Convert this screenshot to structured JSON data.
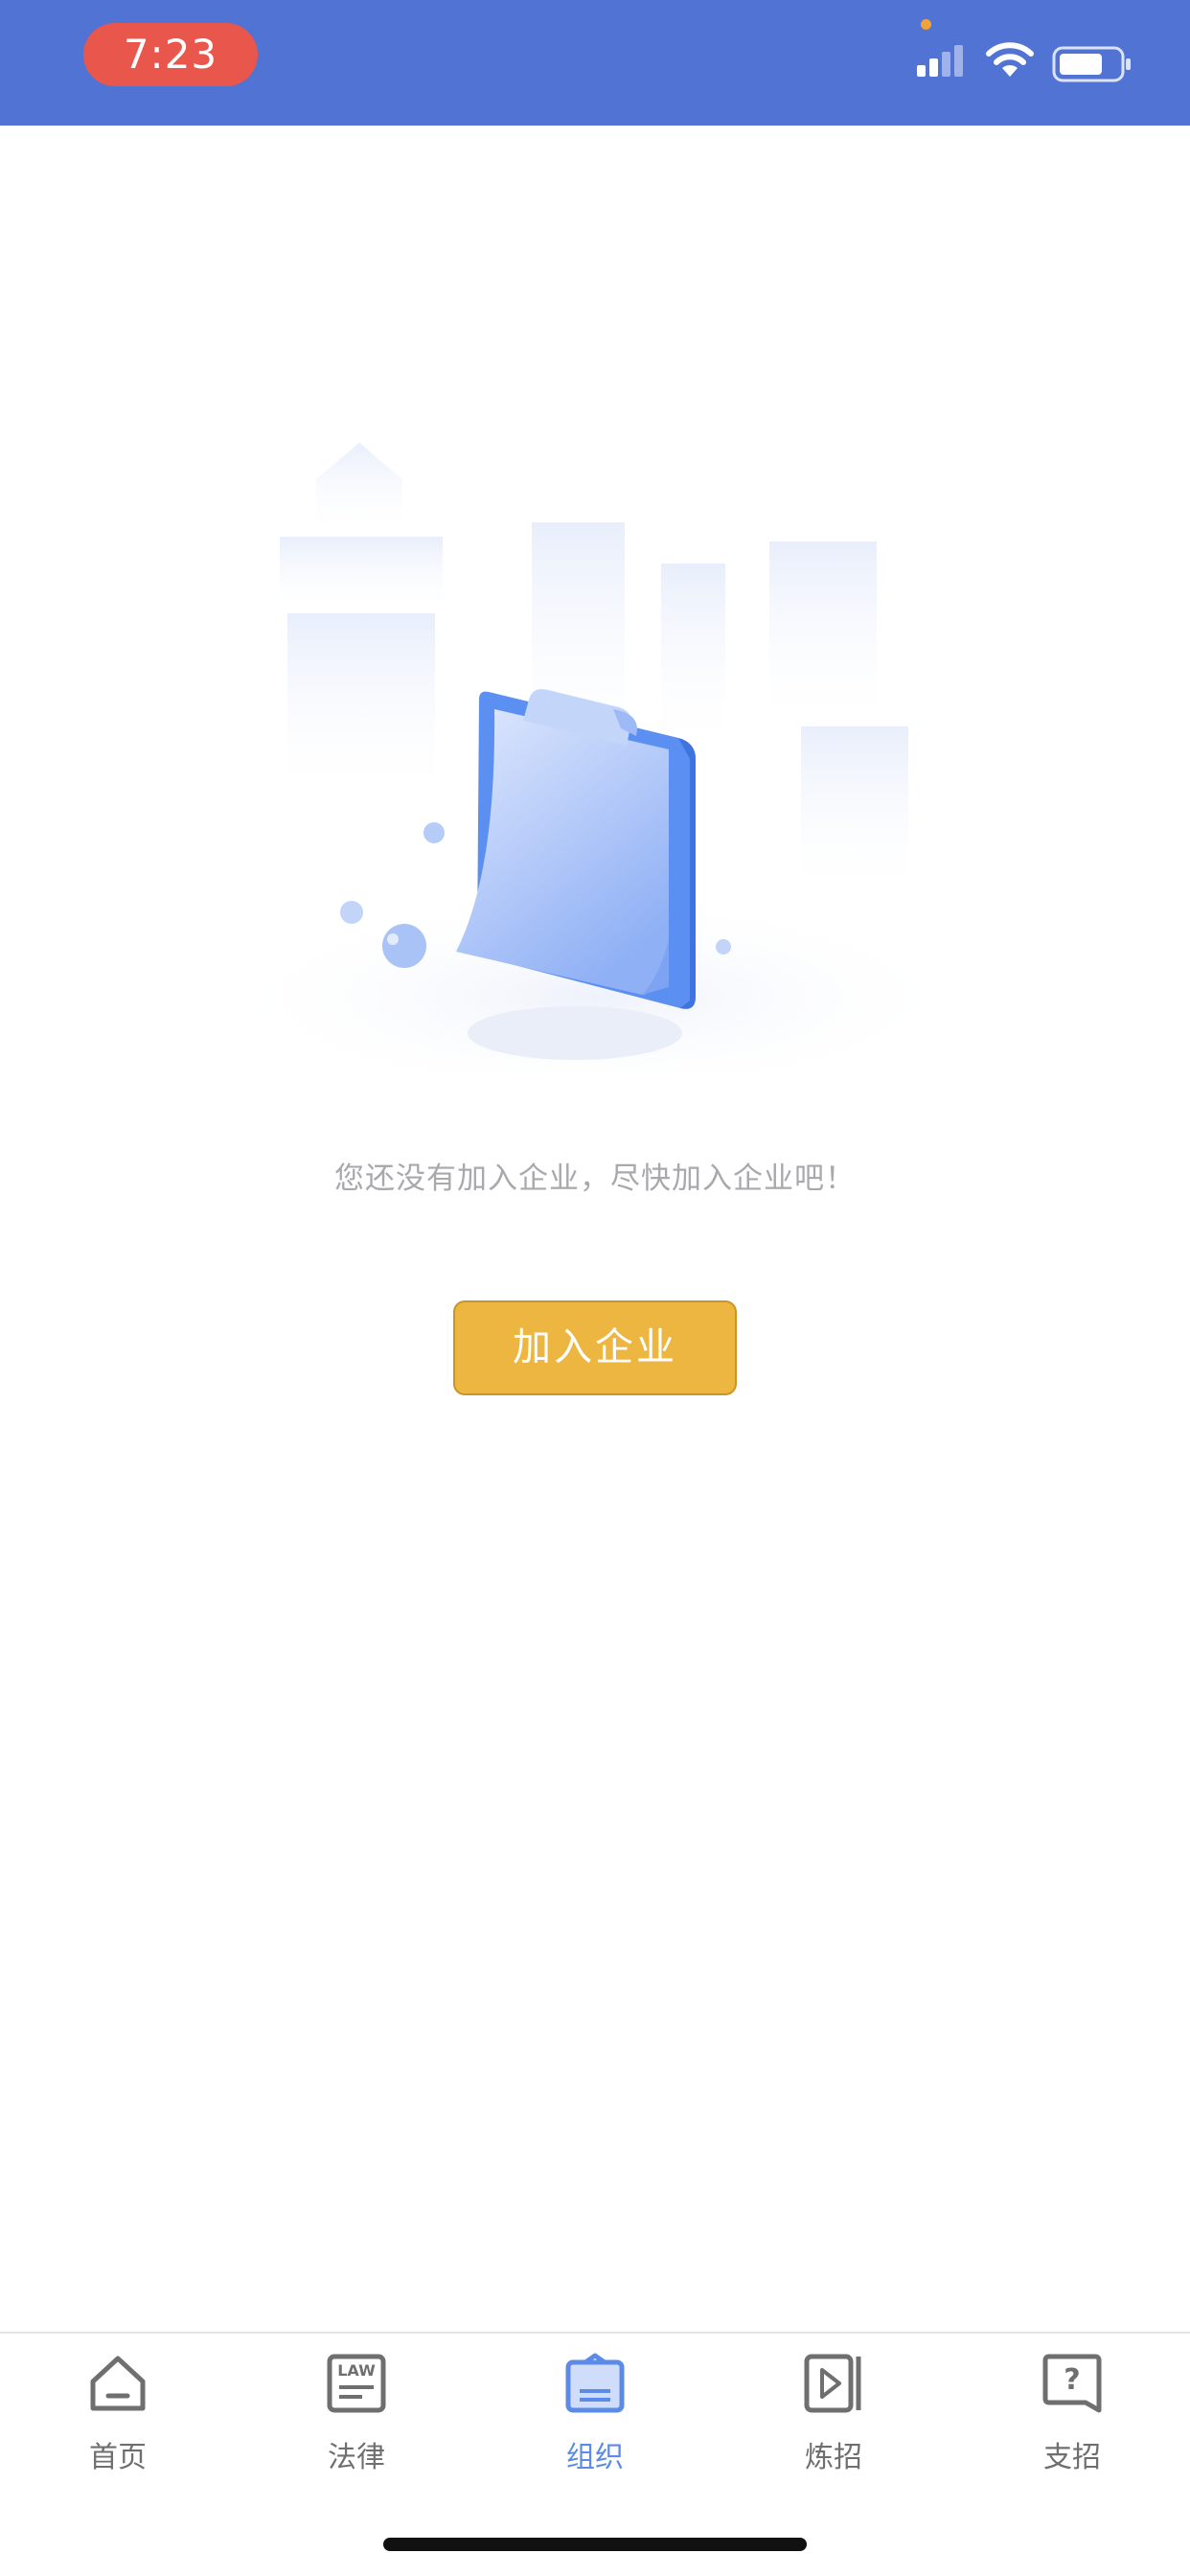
{
  "status_bar": {
    "time": "7:23",
    "icons": [
      "signal-icon",
      "wifi-icon",
      "battery-icon"
    ],
    "background_color": "#5173d3",
    "time_pill_color": "#e9574c"
  },
  "empty_state": {
    "illustration": "clipboard-illustration",
    "message": "您还没有加入企业，尽快加入企业吧！",
    "join_button_label": "加入企业",
    "button_color": "#edb641"
  },
  "tab_bar": {
    "active_tab": "组织",
    "active_color": "#5b8be6",
    "tabs": [
      {
        "label": "首页",
        "icon": "home-icon"
      },
      {
        "label": "法律",
        "icon": "law-icon"
      },
      {
        "label": "组织",
        "icon": "organization-icon"
      },
      {
        "label": "炼招",
        "icon": "video-play-icon"
      },
      {
        "label": "支招",
        "icon": "question-chat-icon"
      }
    ]
  }
}
